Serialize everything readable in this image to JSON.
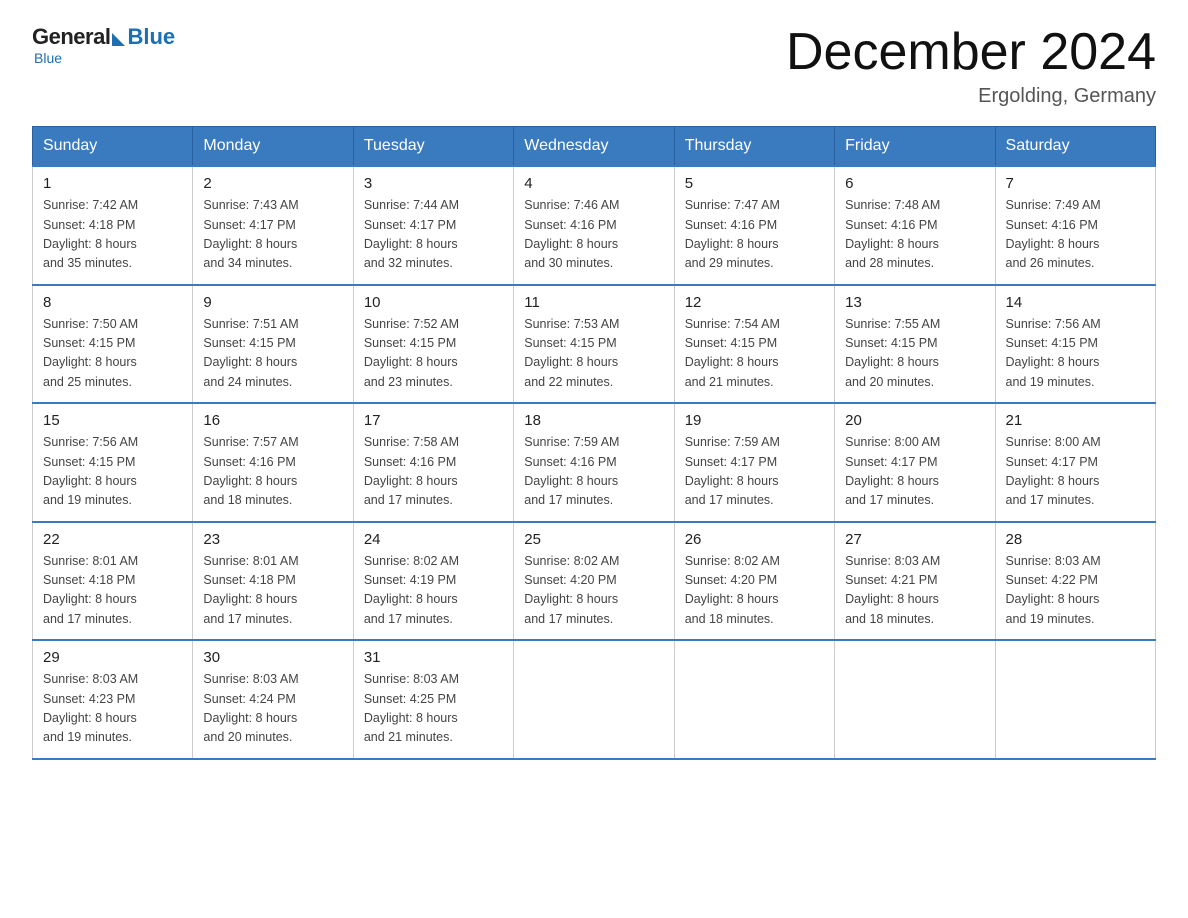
{
  "logo": {
    "general": "General",
    "blue": "Blue",
    "subtitle": "Blue"
  },
  "header": {
    "month": "December 2024",
    "location": "Ergolding, Germany"
  },
  "days_of_week": [
    "Sunday",
    "Monday",
    "Tuesday",
    "Wednesday",
    "Thursday",
    "Friday",
    "Saturday"
  ],
  "weeks": [
    [
      {
        "day": "1",
        "sunrise": "7:42 AM",
        "sunset": "4:18 PM",
        "daylight_h": "8",
        "daylight_m": "35"
      },
      {
        "day": "2",
        "sunrise": "7:43 AM",
        "sunset": "4:17 PM",
        "daylight_h": "8",
        "daylight_m": "34"
      },
      {
        "day": "3",
        "sunrise": "7:44 AM",
        "sunset": "4:17 PM",
        "daylight_h": "8",
        "daylight_m": "32"
      },
      {
        "day": "4",
        "sunrise": "7:46 AM",
        "sunset": "4:16 PM",
        "daylight_h": "8",
        "daylight_m": "30"
      },
      {
        "day": "5",
        "sunrise": "7:47 AM",
        "sunset": "4:16 PM",
        "daylight_h": "8",
        "daylight_m": "29"
      },
      {
        "day": "6",
        "sunrise": "7:48 AM",
        "sunset": "4:16 PM",
        "daylight_h": "8",
        "daylight_m": "28"
      },
      {
        "day": "7",
        "sunrise": "7:49 AM",
        "sunset": "4:16 PM",
        "daylight_h": "8",
        "daylight_m": "26"
      }
    ],
    [
      {
        "day": "8",
        "sunrise": "7:50 AM",
        "sunset": "4:15 PM",
        "daylight_h": "8",
        "daylight_m": "25"
      },
      {
        "day": "9",
        "sunrise": "7:51 AM",
        "sunset": "4:15 PM",
        "daylight_h": "8",
        "daylight_m": "24"
      },
      {
        "day": "10",
        "sunrise": "7:52 AM",
        "sunset": "4:15 PM",
        "daylight_h": "8",
        "daylight_m": "23"
      },
      {
        "day": "11",
        "sunrise": "7:53 AM",
        "sunset": "4:15 PM",
        "daylight_h": "8",
        "daylight_m": "22"
      },
      {
        "day": "12",
        "sunrise": "7:54 AM",
        "sunset": "4:15 PM",
        "daylight_h": "8",
        "daylight_m": "21"
      },
      {
        "day": "13",
        "sunrise": "7:55 AM",
        "sunset": "4:15 PM",
        "daylight_h": "8",
        "daylight_m": "20"
      },
      {
        "day": "14",
        "sunrise": "7:56 AM",
        "sunset": "4:15 PM",
        "daylight_h": "8",
        "daylight_m": "19"
      }
    ],
    [
      {
        "day": "15",
        "sunrise": "7:56 AM",
        "sunset": "4:15 PM",
        "daylight_h": "8",
        "daylight_m": "19"
      },
      {
        "day": "16",
        "sunrise": "7:57 AM",
        "sunset": "4:16 PM",
        "daylight_h": "8",
        "daylight_m": "18"
      },
      {
        "day": "17",
        "sunrise": "7:58 AM",
        "sunset": "4:16 PM",
        "daylight_h": "8",
        "daylight_m": "17"
      },
      {
        "day": "18",
        "sunrise": "7:59 AM",
        "sunset": "4:16 PM",
        "daylight_h": "8",
        "daylight_m": "17"
      },
      {
        "day": "19",
        "sunrise": "7:59 AM",
        "sunset": "4:17 PM",
        "daylight_h": "8",
        "daylight_m": "17"
      },
      {
        "day": "20",
        "sunrise": "8:00 AM",
        "sunset": "4:17 PM",
        "daylight_h": "8",
        "daylight_m": "17"
      },
      {
        "day": "21",
        "sunrise": "8:00 AM",
        "sunset": "4:17 PM",
        "daylight_h": "8",
        "daylight_m": "17"
      }
    ],
    [
      {
        "day": "22",
        "sunrise": "8:01 AM",
        "sunset": "4:18 PM",
        "daylight_h": "8",
        "daylight_m": "17"
      },
      {
        "day": "23",
        "sunrise": "8:01 AM",
        "sunset": "4:18 PM",
        "daylight_h": "8",
        "daylight_m": "17"
      },
      {
        "day": "24",
        "sunrise": "8:02 AM",
        "sunset": "4:19 PM",
        "daylight_h": "8",
        "daylight_m": "17"
      },
      {
        "day": "25",
        "sunrise": "8:02 AM",
        "sunset": "4:20 PM",
        "daylight_h": "8",
        "daylight_m": "17"
      },
      {
        "day": "26",
        "sunrise": "8:02 AM",
        "sunset": "4:20 PM",
        "daylight_h": "8",
        "daylight_m": "18"
      },
      {
        "day": "27",
        "sunrise": "8:03 AM",
        "sunset": "4:21 PM",
        "daylight_h": "8",
        "daylight_m": "18"
      },
      {
        "day": "28",
        "sunrise": "8:03 AM",
        "sunset": "4:22 PM",
        "daylight_h": "8",
        "daylight_m": "19"
      }
    ],
    [
      {
        "day": "29",
        "sunrise": "8:03 AM",
        "sunset": "4:23 PM",
        "daylight_h": "8",
        "daylight_m": "19"
      },
      {
        "day": "30",
        "sunrise": "8:03 AM",
        "sunset": "4:24 PM",
        "daylight_h": "8",
        "daylight_m": "20"
      },
      {
        "day": "31",
        "sunrise": "8:03 AM",
        "sunset": "4:25 PM",
        "daylight_h": "8",
        "daylight_m": "21"
      },
      null,
      null,
      null,
      null
    ]
  ]
}
